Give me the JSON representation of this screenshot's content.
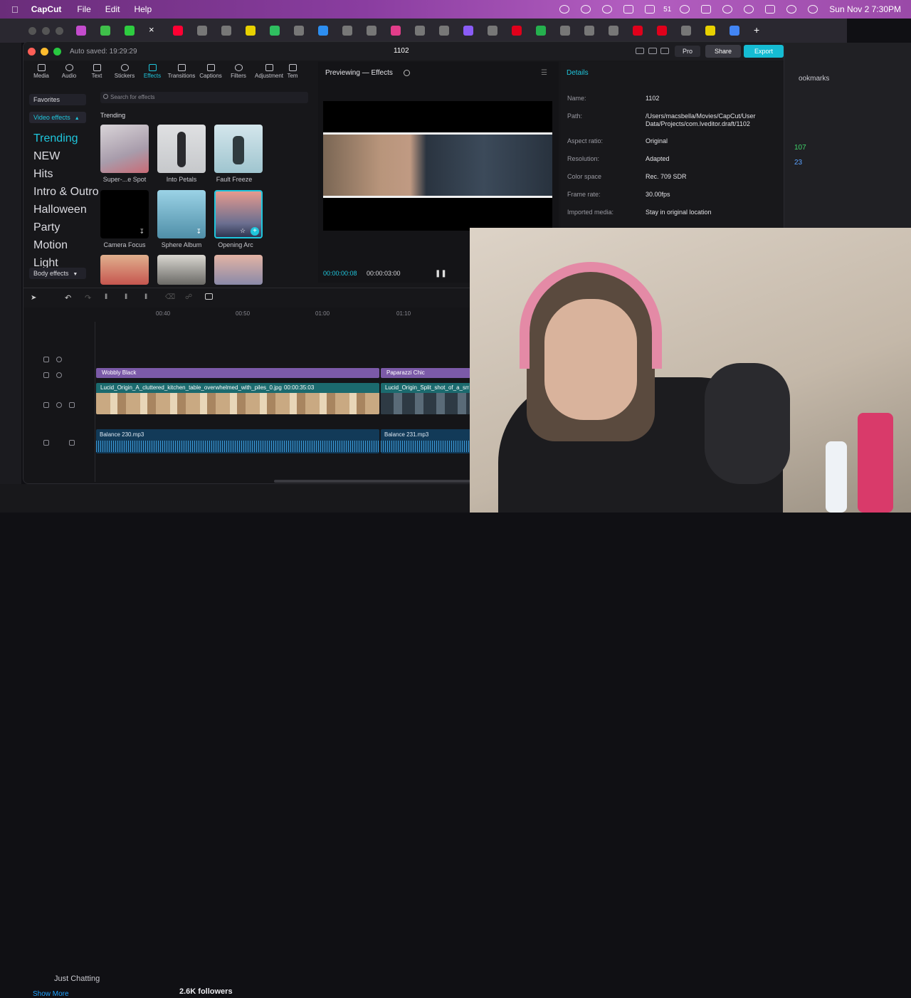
{
  "menubar": {
    "app": "CapCut",
    "items": [
      "File",
      "Edit",
      "Help"
    ],
    "battery": "51",
    "clock": "Sun Nov 2  7:30PM"
  },
  "window": {
    "autosave": "Auto saved: 19:29:29",
    "project": "1102",
    "pro": "Pro",
    "share": "Share",
    "export": "Export"
  },
  "tools": [
    "Media",
    "Audio",
    "Text",
    "Stickers",
    "Effects",
    "Transitions",
    "Captions",
    "Filters",
    "Adjustment",
    "Tem"
  ],
  "categories": {
    "favorites": "Favorites",
    "video_effects": "Video effects",
    "items": [
      "Trending",
      "NEW",
      "Hits",
      "Intro & Outro",
      "Halloween",
      "Party",
      "Motion",
      "Light"
    ],
    "body_effects": "Body effects"
  },
  "search": {
    "placeholder": "Search for effects"
  },
  "trending": {
    "title": "Trending",
    "effects": [
      "Super-...e Spot",
      "Into Petals",
      "Fault Freeze",
      "Camera Focus",
      "Sphere Album",
      "Opening Arc"
    ]
  },
  "preview": {
    "title": "Previewing — Effects",
    "time_current": "00:00:00:08",
    "time_total": "00:00:03:00"
  },
  "details": {
    "title": "Details",
    "rows": [
      {
        "k": "Name:",
        "v": "1102"
      },
      {
        "k": "Path:",
        "v": "/Users/macsbella/Movies/CapCut/User Data/Projects/com.lveditor.draft/1102"
      },
      {
        "k": "Aspect ratio:",
        "v": "Original"
      },
      {
        "k": "Resolution:",
        "v": "Adapted"
      },
      {
        "k": "Color space",
        "v": "Rec. 709 SDR"
      },
      {
        "k": "Frame rate:",
        "v": "30.00fps"
      },
      {
        "k": "Imported media:",
        "v": "Stay in original location"
      }
    ]
  },
  "timeline": {
    "ruler": [
      "00:40",
      "00:50",
      "01:00",
      "01:10"
    ],
    "effects": [
      "Wobbly Black",
      "Paparazzi Chic"
    ],
    "video1": "Lucid_Origin_A_cluttered_kitchen_table_overwhelmed_with_piles_0.jpg",
    "video1_dur": "00:00:35:03",
    "video2": "Lucid_Origin_Split_shot_of_a_smilin",
    "audio1": "Balance 230.mp3",
    "audio2": "Balance 231.mp3"
  },
  "background": {
    "bottom1": "Just Chatting",
    "followers": "2.6K followers",
    "show_more": "Show More",
    "right1": "ookmarks",
    "right2": "107",
    "right3": "23"
  }
}
